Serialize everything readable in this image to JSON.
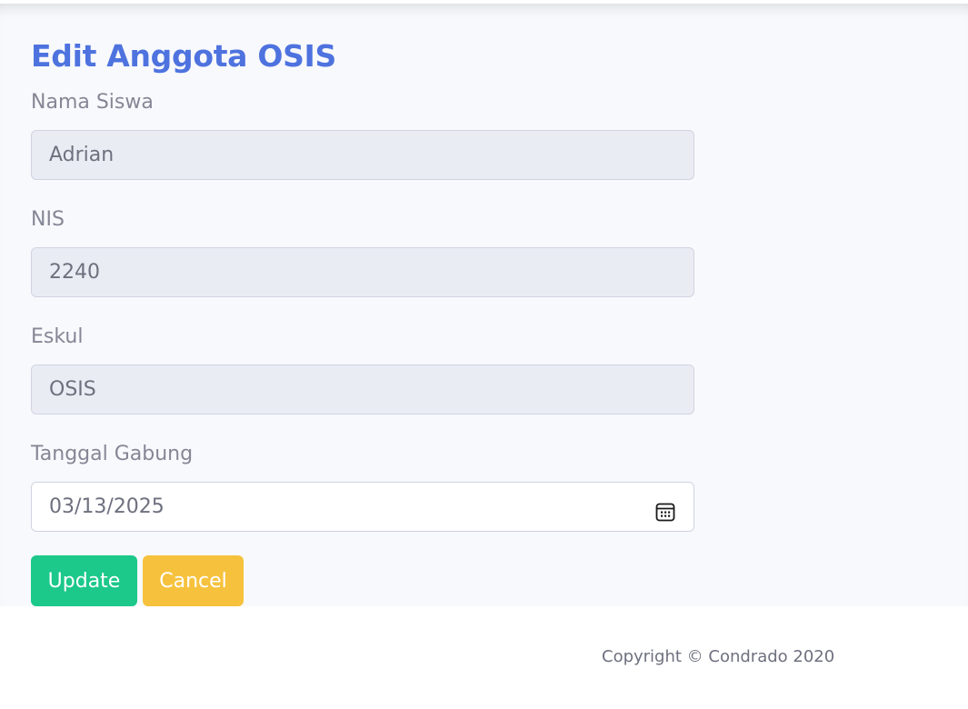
{
  "page": {
    "title": "Edit Anggota OSIS"
  },
  "form": {
    "nama": {
      "label": "Nama Siswa",
      "value": "Adrian"
    },
    "nis": {
      "label": "NIS",
      "value": "2240"
    },
    "eskul": {
      "label": "Eskul",
      "value": "OSIS"
    },
    "tanggal": {
      "label": "Tanggal Gabung",
      "value": "03/13/2025",
      "icon": "calendar-icon"
    }
  },
  "buttons": {
    "update_label": "Update",
    "cancel_label": "Cancel"
  },
  "footer": {
    "copyright": "Copyright © Condrado 2020"
  },
  "colors": {
    "title": "#4e73df",
    "update": "#1cc88a",
    "cancel": "#f6c23e",
    "readonly_bg": "#eaecf4"
  }
}
